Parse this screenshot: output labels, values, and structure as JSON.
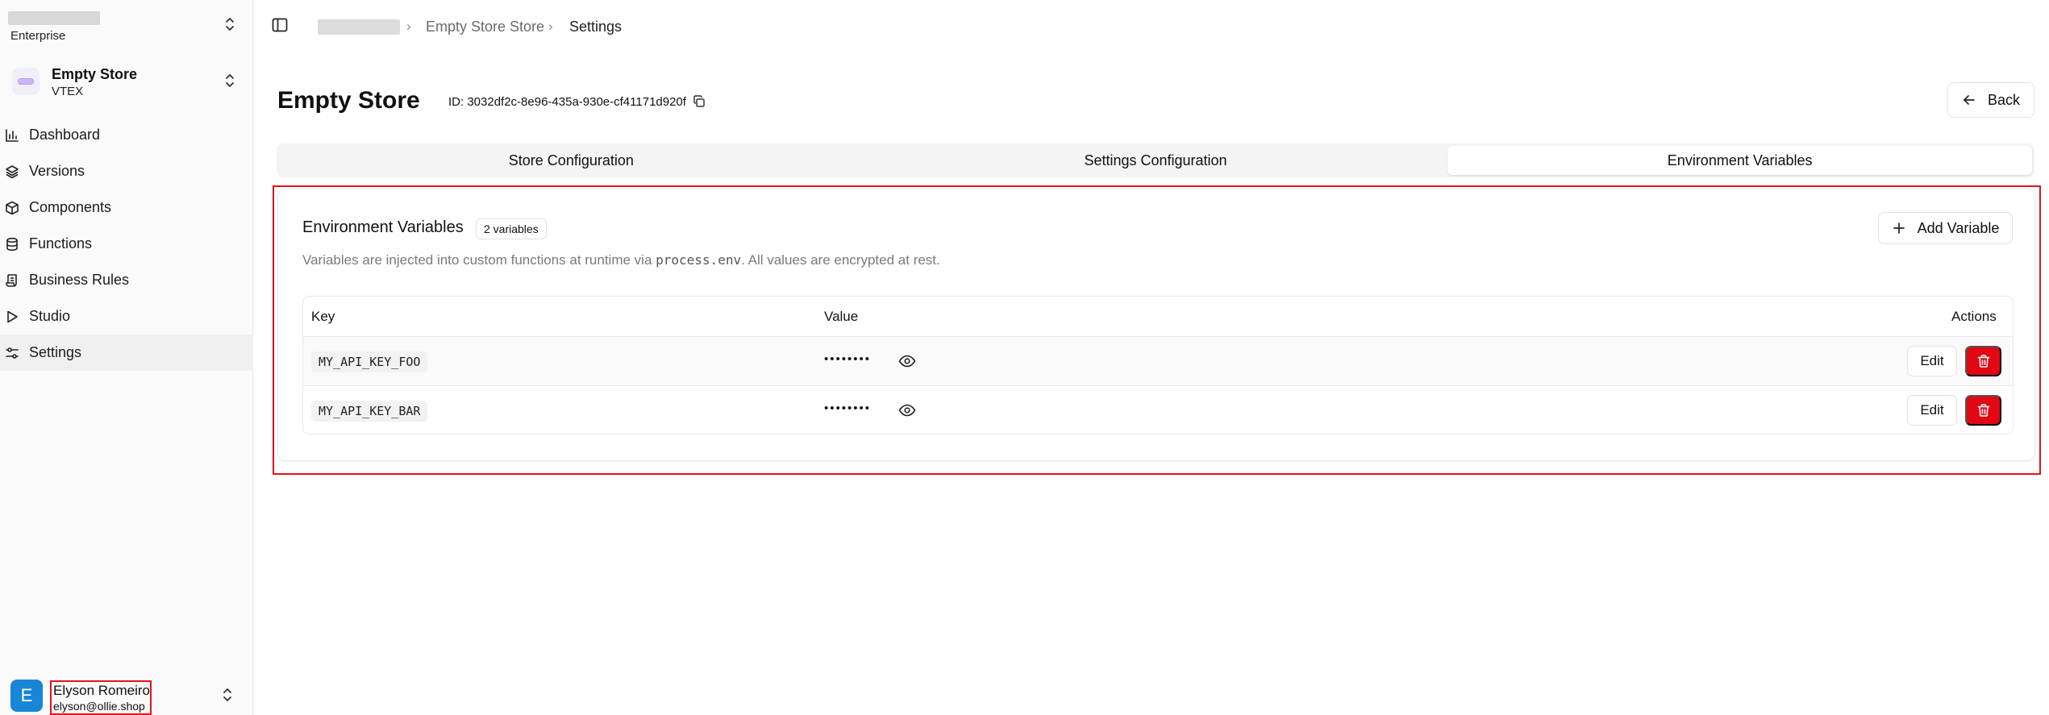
{
  "sidebar": {
    "org": {
      "plan": "Enterprise"
    },
    "store": {
      "name": "Empty Store",
      "platform": "VTEX"
    },
    "items": [
      {
        "label": "Dashboard",
        "icon": "bar-chart-icon"
      },
      {
        "label": "Versions",
        "icon": "layers-icon"
      },
      {
        "label": "Components",
        "icon": "box-icon"
      },
      {
        "label": "Functions",
        "icon": "database-icon"
      },
      {
        "label": "Business Rules",
        "icon": "scroll-icon"
      },
      {
        "label": "Studio",
        "icon": "play-icon"
      },
      {
        "label": "Settings",
        "icon": "sliders-icon"
      }
    ],
    "active": "Settings",
    "user": {
      "initial": "E",
      "name": "Elyson Romeiro",
      "email": "elyson@ollie.shop"
    }
  },
  "breadcrumb": {
    "items": [
      "Empty Store Store",
      "Settings"
    ]
  },
  "header": {
    "title": "Empty Store",
    "id_text": "ID: 3032df2c-8e96-435a-930e-cf41171d920f",
    "back_label": "Back"
  },
  "tabs": [
    {
      "label": "Store Configuration"
    },
    {
      "label": "Settings Configuration"
    },
    {
      "label": "Environment Variables"
    }
  ],
  "active_tab": "Environment Variables",
  "env_panel": {
    "title": "Environment Variables",
    "count_badge": "2 variables",
    "desc_before": "Variables are injected into custom functions at runtime via ",
    "desc_code": "process.env",
    "desc_after": ". All values are encrypted at rest.",
    "add_label": "Add Variable",
    "columns": {
      "key": "Key",
      "value": "Value",
      "actions": "Actions"
    },
    "rows": [
      {
        "key": "MY_API_KEY_FOO",
        "value": "••••••••",
        "edit": "Edit"
      },
      {
        "key": "MY_API_KEY_BAR",
        "value": "••••••••",
        "edit": "Edit"
      }
    ]
  },
  "colors": {
    "accent_red": "#e30613",
    "highlight": "#e0141c",
    "avatar": "#1786d6"
  }
}
